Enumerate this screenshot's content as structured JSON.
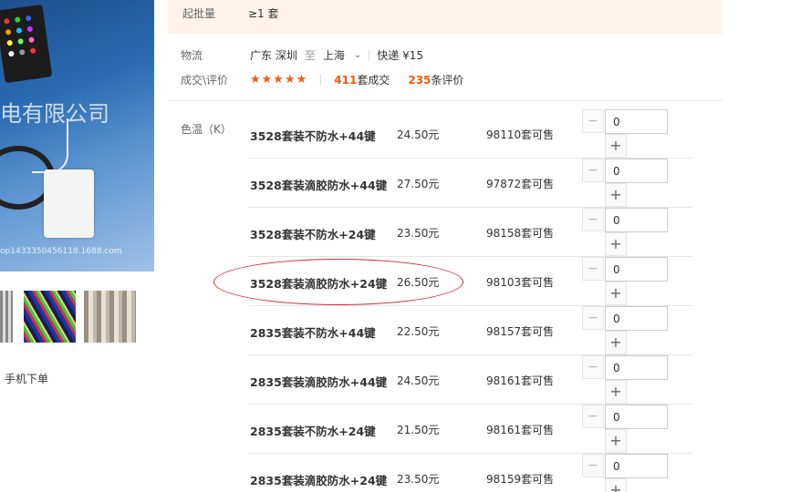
{
  "images": {
    "main_watermark": "电有限公司",
    "main_url": "op1433350456118.1688.com"
  },
  "mobile_order": "手机下单",
  "minbatch": {
    "label": "起批量",
    "value": "≥1 套"
  },
  "logistics": {
    "label": "物流",
    "from": "广东 深圳",
    "to_word": "至",
    "to": "上海",
    "shipping": "快递 ¥15"
  },
  "reviews": {
    "label": "成交\\评价",
    "stars": "★★★★★",
    "orders_count": "411",
    "orders_suffix": "套成交",
    "reviews_count": "235",
    "reviews_suffix": "条评价"
  },
  "color_temp_label": "色温（K）",
  "skus": [
    {
      "name": "3528套装不防水+44键",
      "price": "24.50元",
      "stock": "98110套可售",
      "qty": "0"
    },
    {
      "name": "3528套装滴胶防水+44键",
      "price": "27.50元",
      "stock": "97872套可售",
      "qty": "0"
    },
    {
      "name": "3528套装不防水+24键",
      "price": "23.50元",
      "stock": "98158套可售",
      "qty": "0"
    },
    {
      "name": "3528套装滴胶防水+24键",
      "price": "26.50元",
      "stock": "98103套可售",
      "qty": "0"
    },
    {
      "name": "2835套装不防水+44键",
      "price": "22.50元",
      "stock": "98157套可售",
      "qty": "0"
    },
    {
      "name": "2835套装滴胶防水+44键",
      "price": "24.50元",
      "stock": "98161套可售",
      "qty": "0"
    },
    {
      "name": "2835套装不防水+24键",
      "price": "21.50元",
      "stock": "98161套可售",
      "qty": "0"
    },
    {
      "name": "2835套装滴胶防水+24键",
      "price": "23.50元",
      "stock": "98159套可售",
      "qty": "0"
    }
  ],
  "stepper": {
    "minus": "−",
    "plus": "+"
  },
  "colors": {
    "accent": "#f65a0c",
    "highlight": "#d9283a",
    "minbatch_bg": "#fdf3ea"
  }
}
